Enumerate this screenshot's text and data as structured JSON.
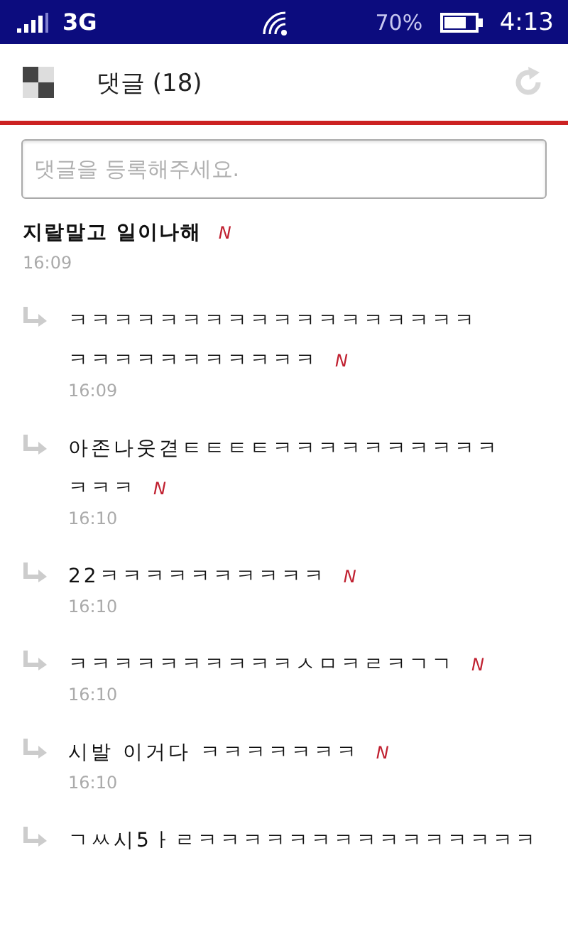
{
  "status_bar": {
    "network": "3G",
    "battery": "70%",
    "time": "4:13"
  },
  "header": {
    "title": "댓글 (18)"
  },
  "comment_field": {
    "placeholder": "댓글을 등록해주세요."
  },
  "comments": [
    {
      "kind": "comment",
      "lines": [
        "지랄말고 일이나해"
      ],
      "badge": "N",
      "time": "16:09"
    },
    {
      "kind": "reply",
      "lines": [
        "ㅋㅋㅋㅋㅋㅋㅋㅋㅋㅋㅋㅋㅋㅋㅋㅋㅋㅋ",
        "ㅋㅋㅋㅋㅋㅋㅋㅋㅋㅋㅋ"
      ],
      "badge": "N",
      "time": "16:09"
    },
    {
      "kind": "reply",
      "lines": [
        "아존나웃겯ㅌㅌㅌㅌㅋㅋㅋㅋㅋㅋㅋㅋㅋㅋ",
        "ㅋㅋㅋ"
      ],
      "badge": "N",
      "time": "16:10"
    },
    {
      "kind": "reply",
      "lines": [
        "22ㅋㅋㅋㅋㅋㅋㅋㅋㅋㅋ"
      ],
      "badge": "N",
      "time": "16:10"
    },
    {
      "kind": "reply",
      "lines": [
        "ㅋㅋㅋㅋㅋㅋㅋㅋㅋㅋㅅㅁㅋㄹㅋㄱㄱ"
      ],
      "badge": "N",
      "time": "16:10"
    },
    {
      "kind": "reply",
      "lines": [
        "시발 이거다 ㅋㅋㅋㅋㅋㅋㅋ"
      ],
      "badge": "N",
      "time": "16:10"
    },
    {
      "kind": "reply",
      "lines": [
        "ㄱㅆ시5ㅏㄹㅋㅋㅋㅋㅋㅋㅋㅋㅋㅋㅋㅋㅋㅋㅋ"
      ]
    }
  ]
}
